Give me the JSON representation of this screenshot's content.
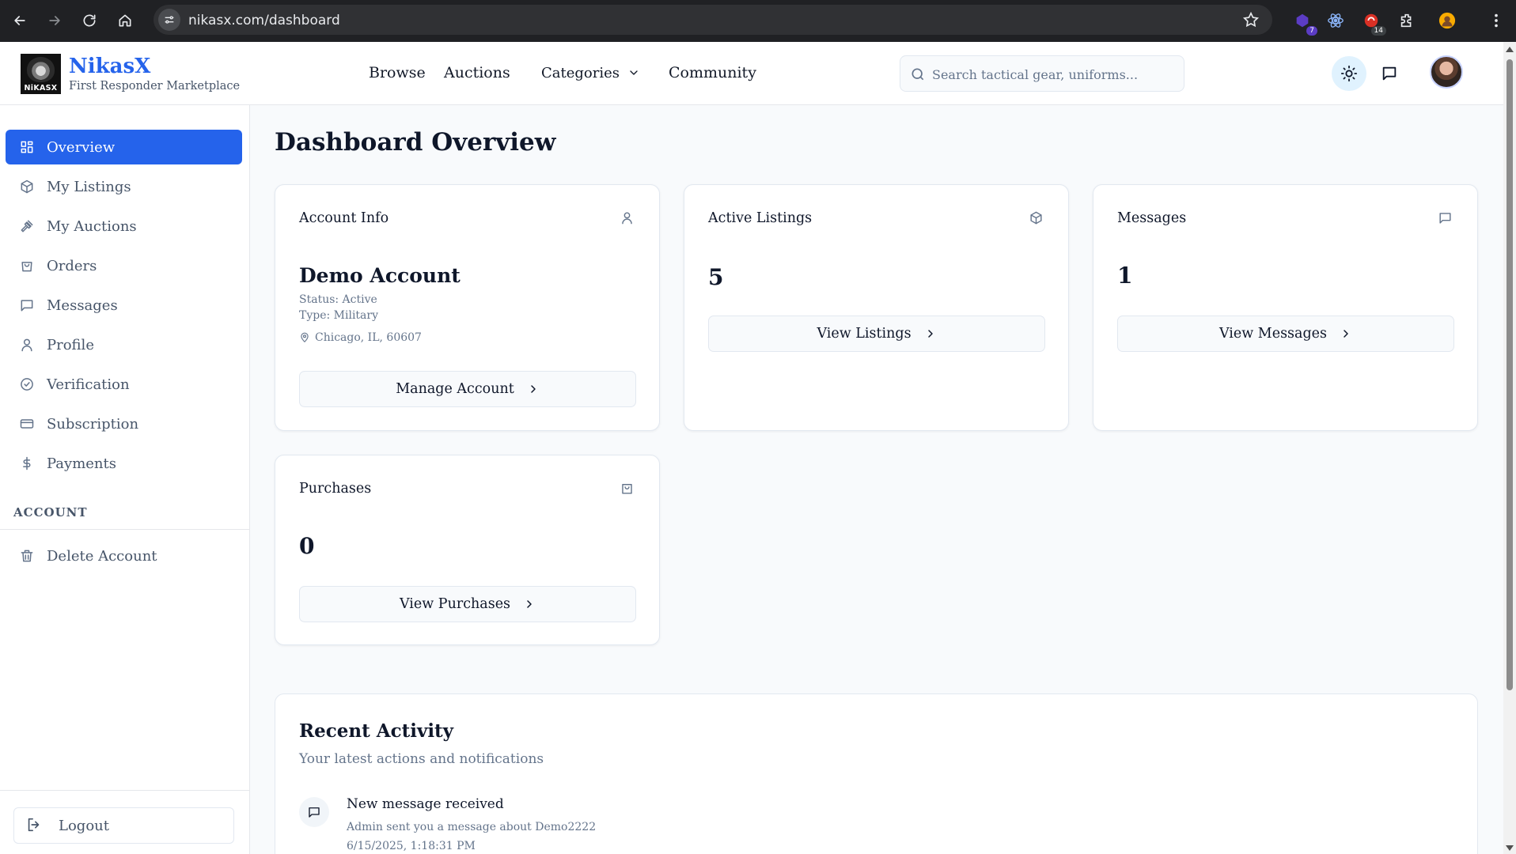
{
  "browser": {
    "url": "nikasx.com/dashboard",
    "extensions": [
      {
        "name": "extension-1-icon",
        "badge": "7"
      },
      {
        "name": "react-devtools-icon",
        "badge": ""
      },
      {
        "name": "extension-3-icon",
        "badge": "14"
      }
    ]
  },
  "header": {
    "logo_text": "NiKASX",
    "brand_name": "NikasX",
    "tagline": "First Responder Marketplace",
    "nav": {
      "browse": "Browse",
      "auctions": "Auctions",
      "categories": "Categories",
      "community": "Community"
    },
    "search_placeholder": "Search tactical gear, uniforms..."
  },
  "sidebar": {
    "items": [
      {
        "label": "Overview",
        "icon": "grid-icon",
        "active": true
      },
      {
        "label": "My Listings",
        "icon": "package-icon"
      },
      {
        "label": "My Auctions",
        "icon": "gavel-icon"
      },
      {
        "label": "Orders",
        "icon": "shopping-bag-icon"
      },
      {
        "label": "Messages",
        "icon": "message-icon"
      },
      {
        "label": "Profile",
        "icon": "user-icon"
      },
      {
        "label": "Verification",
        "icon": "check-circle-icon"
      },
      {
        "label": "Subscription",
        "icon": "credit-card-icon"
      },
      {
        "label": "Payments",
        "icon": "dollar-icon"
      }
    ],
    "section_account": "ACCOUNT",
    "delete_account": "Delete Account",
    "logout": "Logout"
  },
  "main": {
    "title": "Dashboard Overview",
    "account_card": {
      "title": "Account Info",
      "name": "Demo Account",
      "status": "Status: Active",
      "type": "Type: Military",
      "location": "Chicago, IL, 60607",
      "action": "Manage Account"
    },
    "listings_card": {
      "title": "Active Listings",
      "value": "5",
      "action": "View Listings"
    },
    "messages_card": {
      "title": "Messages",
      "value": "1",
      "action": "View Messages"
    },
    "purchases_card": {
      "title": "Purchases",
      "value": "0",
      "action": "View Purchases"
    },
    "activity": {
      "title": "Recent Activity",
      "subtitle": "Your latest actions and notifications",
      "items": [
        {
          "title": "New message received",
          "description": "Admin sent you a message about Demo2222",
          "time": "6/15/2025, 1:18:31 PM"
        }
      ]
    }
  },
  "colors": {
    "accent": "#2563eb",
    "background": "#f8fafc",
    "chrome": "#202124"
  }
}
